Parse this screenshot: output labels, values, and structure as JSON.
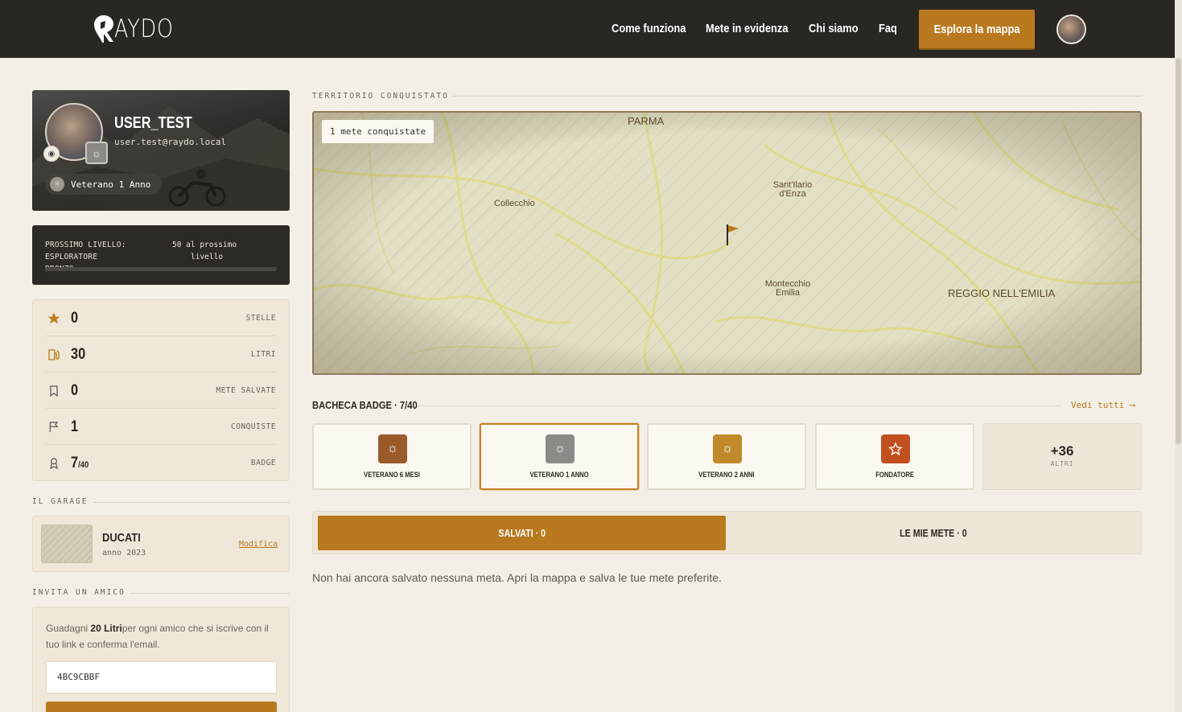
{
  "nav": {
    "logo": "AYDO",
    "links": [
      "Come funziona",
      "Mete in evidenza",
      "Chi siamo",
      "Faq"
    ],
    "cta": "Esplora la mappa"
  },
  "profile": {
    "username": "USER_TEST",
    "email": "user.test@raydo.local",
    "badge": "Veterano 1 Anno"
  },
  "level": {
    "left_line1": "PROSSIMO LIVELLO: ESPLORATORE",
    "left_line2": "BRONZO",
    "right_line1": "50 al prossimo",
    "right_line2": "livello",
    "progress": 0
  },
  "stats": [
    {
      "icon": "star-icon",
      "value": "0",
      "label": "STELLE"
    },
    {
      "icon": "fuel-icon",
      "value": "30",
      "label": "LITRI"
    },
    {
      "icon": "bookmark-icon",
      "value": "0",
      "label": "METE SALVATE"
    },
    {
      "icon": "flag-icon",
      "value": "1",
      "label": "CONQUISTE"
    },
    {
      "icon": "badge-icon",
      "value": "7",
      "suffix": "/40",
      "label": "BADGE"
    }
  ],
  "garage": {
    "title": "IL GARAGE",
    "bike": "DUCATI",
    "year": "anno 2023",
    "edit": "Modifica"
  },
  "invite": {
    "title": "INVITA UN AMICO",
    "text_pre": "Guadagni ",
    "text_bold": "20 Litri",
    "text_post": "per ogni amico che si iscrive con il tuo link e conferma l'email.",
    "code": "4BC9CBBF"
  },
  "territory": {
    "title": "TERRITORIO CONQUISTATO",
    "chip": "1 mete conquistate",
    "places": {
      "parma": "PARMA",
      "collecchio": "Collecchio",
      "santilario1": "Sant'Ilario",
      "santilario2": "d'Enza",
      "montecchio1": "Montecchio",
      "montecchio2": "Emilia",
      "reggio": "REGGIO NELL'EMILIA"
    }
  },
  "badges": {
    "title": "BACHECA BADGE · 7/40",
    "see_all": "Vedi tutti ⟶",
    "items": [
      {
        "name": "VETERANO 6 MESI",
        "color": "#9a5a2a"
      },
      {
        "name": "VETERANO 1 ANNO",
        "color": "#8c8a87"
      },
      {
        "name": "VETERANO 2 ANNI",
        "color": "#c08a2a"
      },
      {
        "name": "FONDATORE",
        "color": "#c2501f"
      }
    ],
    "more_num": "+36",
    "more_label": "ALTRI"
  },
  "tabs": {
    "saved": "SALVATI · 0",
    "mine": "LE MIE METE · 0"
  },
  "empty_message": "Non hai ancora salvato nessuna meta. Apri la mappa e salva le tue mete preferite.",
  "colors": {
    "accent": "#b8791f",
    "dark": "#2a2723",
    "bg": "#f3efe6"
  }
}
